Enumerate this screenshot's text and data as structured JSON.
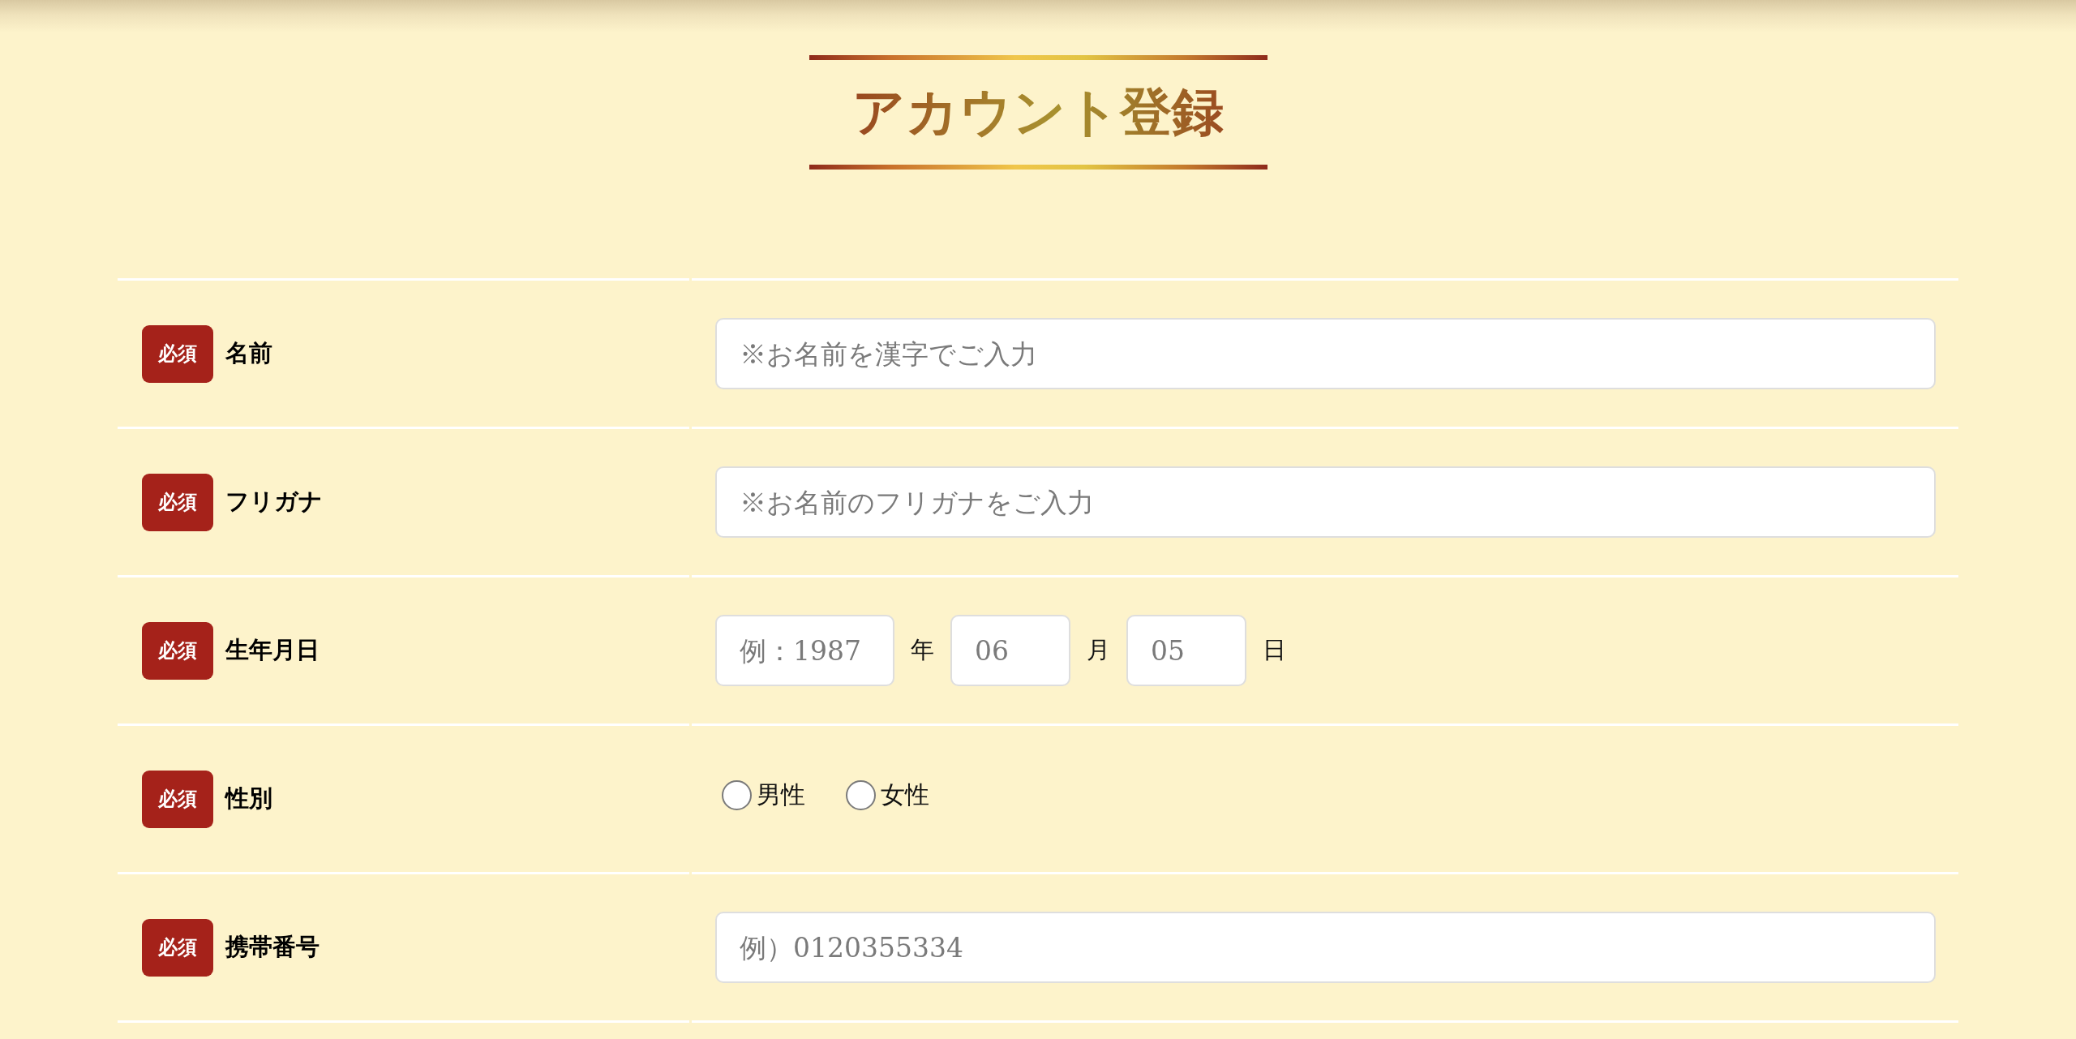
{
  "title": "アカウント登録",
  "fields": [
    {
      "kind": "text",
      "badge": "必須",
      "label": "名前",
      "placeholder": "※お名前を漢字でご入力"
    },
    {
      "kind": "text",
      "badge": "必須",
      "label": "フリガナ",
      "placeholder": "※お名前のフリガナをご入力"
    },
    {
      "kind": "date",
      "badge": "必須",
      "label": "生年月日",
      "parts": [
        {
          "placeholder": "例：1987",
          "unit": "年"
        },
        {
          "placeholder": "06",
          "unit": "月"
        },
        {
          "placeholder": "05",
          "unit": "日"
        }
      ]
    },
    {
      "kind": "radio",
      "badge": "必須",
      "label": "性別",
      "options": [
        {
          "label": "男性",
          "selected": false
        },
        {
          "label": "女性",
          "selected": false
        }
      ]
    },
    {
      "kind": "text",
      "badge": "必須",
      "label": "携帯番号",
      "placeholder": "例）0120355334"
    }
  ]
}
